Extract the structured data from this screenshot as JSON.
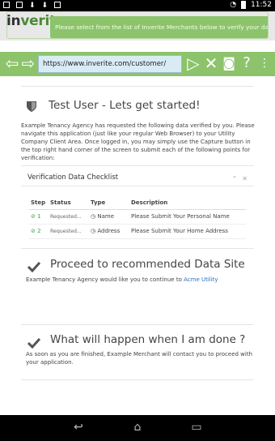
{
  "statusbar": {
    "time": "11:52"
  },
  "app": {
    "logo_in": "in",
    "logo_rest": "verite",
    "notice": "Please select from the list of Inverite Merchants below to verify your data..."
  },
  "browser": {
    "url": "https://www.inverite.com/customer/",
    "icons": [
      "back-arrow-icon",
      "forward-arrow-icon",
      "play-icon",
      "close-icon",
      "camera-icon",
      "help-icon"
    ]
  },
  "section1": {
    "title": "Test User - Lets get started!",
    "intro": "Example Tenancy Agency has requested the following data verified by you. Please navigate this application (just like your regular Web Browser) to your Utility Company Client Area. Once logged in, you may simply use the Capture button in the top right hand corner of the screen to submit each of the following points for verification:"
  },
  "checklist": {
    "title": "Verification Data Checklist",
    "headers": [
      "Step",
      "Status",
      "Type",
      "Description"
    ],
    "rows": [
      {
        "step": "1",
        "status": "Requested...",
        "type": "Name",
        "description": "Please Submit Your Personal Name"
      },
      {
        "step": "2",
        "status": "Requested...",
        "type": "Address",
        "description": "Please Submit Your Home Address"
      }
    ]
  },
  "section2": {
    "title": "Proceed to recommended Data Site",
    "text": "Example Tenancy Agency would like you to continue to",
    "link": "Acme Utility"
  },
  "section3": {
    "title": "What will happen when I am done ?",
    "text": "As soon as you are finished, Example Merchant will contact you to proceed with your application."
  },
  "colors": {
    "green": "#8cc36b",
    "logo_green": "#4a8b34",
    "link": "#2a72c2"
  }
}
